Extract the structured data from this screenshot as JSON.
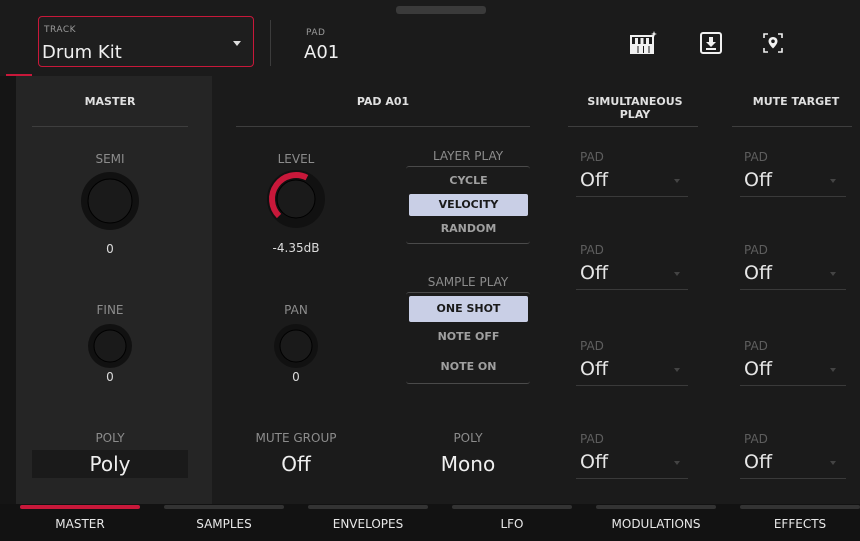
{
  "header": {
    "track_label": "TRACK",
    "track_value": "Drum Kit",
    "pad_label": "PAD",
    "pad_value": "A01",
    "icons": [
      "keyboard-plus-icon",
      "download-icon",
      "locate-icon"
    ]
  },
  "master": {
    "title": "MASTER",
    "semi_label": "SEMI",
    "semi_value": "0",
    "fine_label": "FINE",
    "fine_value": "0",
    "poly_label": "POLY",
    "poly_value": "Poly"
  },
  "pad_section": {
    "title": "PAD A01",
    "level_label": "LEVEL",
    "level_value": "-4.35dB",
    "level_fraction": 0.6,
    "pan_label": "PAN",
    "pan_value": "0",
    "mute_group_label": "MUTE GROUP",
    "mute_group_value": "Off",
    "poly_label": "POLY",
    "poly_value": "Mono",
    "layer_play": {
      "label": "LAYER PLAY",
      "options": [
        "CYCLE",
        "VELOCITY",
        "RANDOM"
      ],
      "selected": "VELOCITY"
    },
    "sample_play": {
      "label": "SAMPLE PLAY",
      "options": [
        "ONE SHOT",
        "NOTE OFF",
        "NOTE ON"
      ],
      "selected": "ONE SHOT"
    }
  },
  "simultaneous_play": {
    "title": "SIMULTANEOUS PLAY",
    "pads": [
      {
        "label": "PAD",
        "value": "Off"
      },
      {
        "label": "PAD",
        "value": "Off"
      },
      {
        "label": "PAD",
        "value": "Off"
      },
      {
        "label": "PAD",
        "value": "Off"
      }
    ]
  },
  "mute_target": {
    "title": "MUTE TARGET",
    "pads": [
      {
        "label": "PAD",
        "value": "Off"
      },
      {
        "label": "PAD",
        "value": "Off"
      },
      {
        "label": "PAD",
        "value": "Off"
      },
      {
        "label": "PAD",
        "value": "Off"
      }
    ]
  },
  "tabs": [
    {
      "label": "MASTER",
      "active": true
    },
    {
      "label": "SAMPLES",
      "active": false
    },
    {
      "label": "ENVELOPES",
      "active": false
    },
    {
      "label": "LFO",
      "active": false
    },
    {
      "label": "MODULATIONS",
      "active": false
    },
    {
      "label": "EFFECTS",
      "active": false
    }
  ],
  "colors": {
    "accent": "#c8183a",
    "selected_option": "#c9cfe6",
    "panel": "#252525",
    "background": "#1b1b1b"
  }
}
